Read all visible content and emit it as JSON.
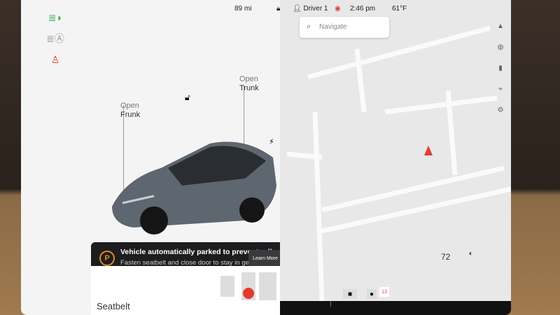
{
  "status": {
    "range": "89 mi",
    "driver": "Driver 1",
    "time": "2:46 pm",
    "temp": "61°F"
  },
  "left_icons": [
    "headlights-icon",
    "auto-headlights-icon",
    "seatbelt-warning-icon"
  ],
  "frunk": {
    "line1": "Open",
    "line2": "Frunk"
  },
  "trunk": {
    "line1": "Open",
    "line2": "Trunk"
  },
  "alert": {
    "title": "Vehicle automatically parked to prevent rollaway",
    "subtitle": "Fasten seatbelt and close door to stay in gear",
    "button": "Learn More",
    "icon": "P"
  },
  "seatbelt_label": "Seatbelt",
  "navigate_placeholder": "Navigate",
  "climate": {
    "temp": "72"
  },
  "colors": {
    "accent_red": "#e23b2e",
    "alert_orange": "#e08a1e",
    "headlight_green": "#2fae4a"
  }
}
